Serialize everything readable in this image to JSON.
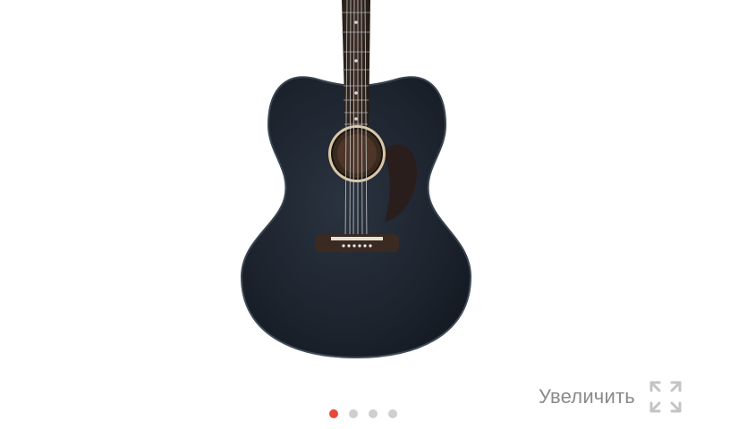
{
  "gallery": {
    "image": {
      "subject": "guitar-image",
      "body_color": "#1d2530"
    },
    "dots": [
      {
        "active": true
      },
      {
        "active": false
      },
      {
        "active": false
      },
      {
        "active": false
      }
    ],
    "accent_color": "#e8473b",
    "zoom": {
      "label": "Увеличить",
      "icon": "expand-icon"
    }
  }
}
